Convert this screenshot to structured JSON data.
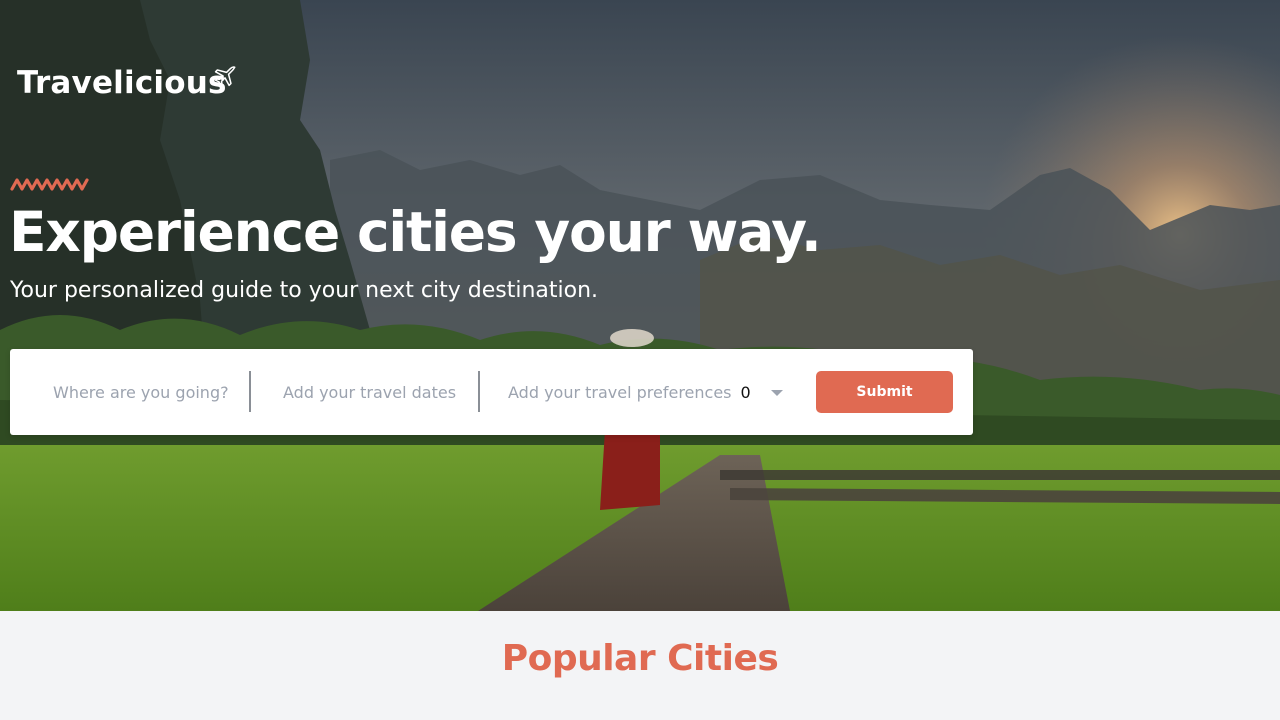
{
  "brand": {
    "name": "Travelicious",
    "logo_icon": "airplane-icon"
  },
  "hero": {
    "decoration_icon": "squiggle-icon",
    "headline": "Experience cities your way.",
    "subheadline": "Your personalized guide to your next city destination."
  },
  "search": {
    "destination_placeholder": "Where are you going?",
    "dates_placeholder": "Add your travel dates",
    "preferences_placeholder": "Add your travel preferences",
    "preferences_count": "0",
    "preferences_dropdown_icon": "caret-down-icon",
    "submit_label": "Submit"
  },
  "popular": {
    "title": "Popular Cities"
  },
  "colors": {
    "accent": "#e06a52",
    "section_bg": "#f3f4f6",
    "search_bg": "#ffffff",
    "placeholder": "#9ca3af"
  }
}
